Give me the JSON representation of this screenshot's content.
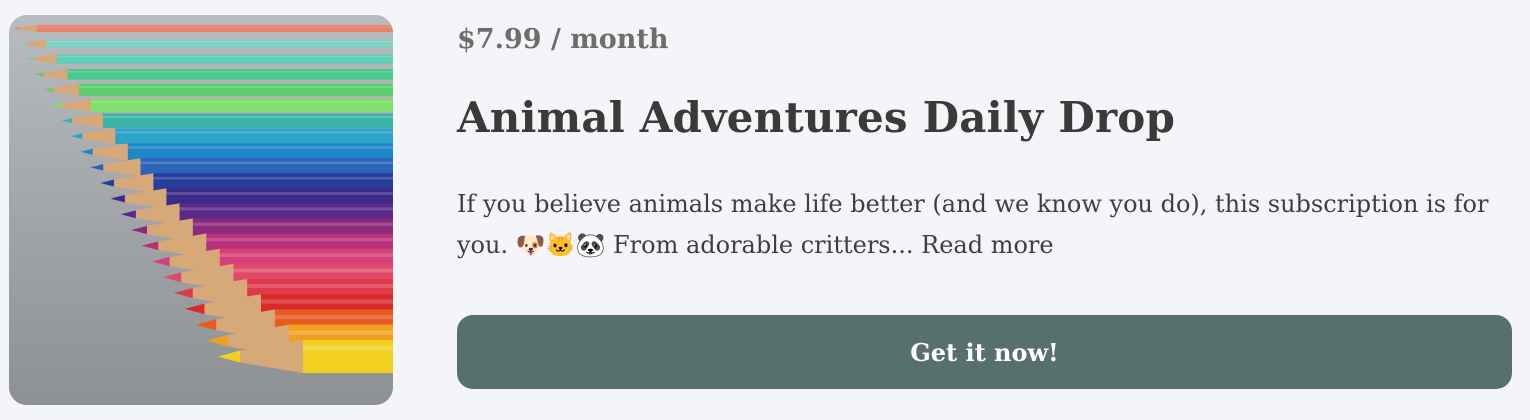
{
  "product": {
    "price": "$7.99 / month",
    "title": "Animal Adventures Daily Drop",
    "description": "If you believe animals make life better (and we know you do), this subscription is for you. 🐶🐱🐼 From adorable critters...",
    "read_more": "Read more",
    "cta_label": "Get it now!",
    "image_subject": "colored-pencils-rainbow"
  },
  "colors": {
    "background": "#f4f5f9",
    "cta_background": "#58706b",
    "cta_text": "#ffffff",
    "text": "#3d3d3d",
    "price_text": "#6d6d6d"
  }
}
